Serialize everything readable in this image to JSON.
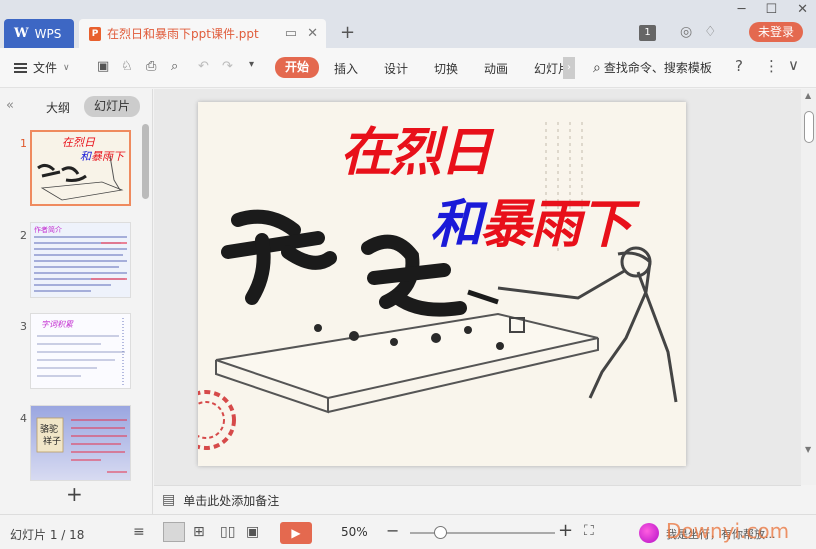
{
  "titlebar": {
    "app_tab": "WPS",
    "doc_tab": "在烈日和暴雨下ppt课件.ppt",
    "page_badge": "1",
    "login": "未登录"
  },
  "ribbon": {
    "file": "文件",
    "tabs": [
      "开始",
      "插入",
      "设计",
      "切换",
      "动画",
      "幻灯片"
    ],
    "search": "查找命令、搜索模板"
  },
  "left_panel": {
    "outline": "大纲",
    "slides": "幻灯片",
    "thumbnails": [
      {
        "num": "1",
        "title": "在烈日和暴雨下"
      },
      {
        "num": "2",
        "title": "作者简介"
      },
      {
        "num": "3",
        "title": "字词积累"
      },
      {
        "num": "4",
        "title": "骆驼祥子"
      }
    ]
  },
  "slide": {
    "title_line1": "在烈日",
    "title_line2_blue": "和",
    "title_line2_red": "暴雨下"
  },
  "notes": {
    "placeholder": "单击此处添加备注"
  },
  "status": {
    "counter": "幻灯片 1 / 18",
    "zoom": "50%",
    "chat": "我是坐行，有你帮放..."
  },
  "watermark": "Downyi.com",
  "colors": {
    "accent": "#e4694f",
    "wps_blue": "#3d67c4",
    "title_red": "#e8101a",
    "title_blue": "#1a1ad8"
  }
}
